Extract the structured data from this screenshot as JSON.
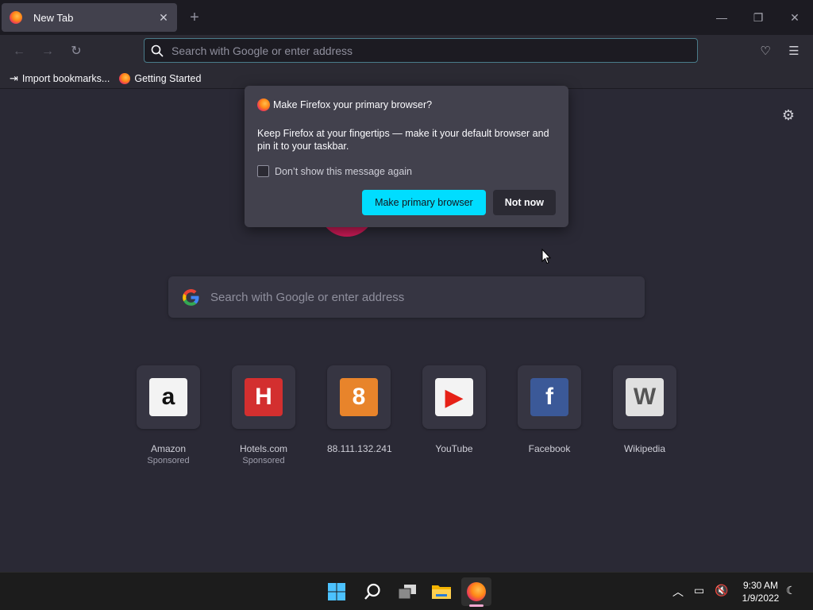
{
  "window": {
    "tab_title": "New Tab",
    "tab_close": "✕",
    "new_tab": "+",
    "minimize": "—",
    "restore": "❐",
    "close": "✕"
  },
  "navbar": {
    "back": "←",
    "forward": "→",
    "reload": "↻",
    "url_placeholder": "Search with Google or enter address",
    "pocket": "♡",
    "menu": "☰"
  },
  "bookmarks": {
    "items": [
      {
        "label": "Import bookmarks...",
        "icon": "import-icon"
      },
      {
        "label": "Getting Started",
        "icon": "firefox-icon"
      }
    ]
  },
  "newtab": {
    "search_placeholder": "Search with Google or enter address",
    "settings": "⚙",
    "tiles": [
      {
        "name": "Amazon",
        "sub": "Sponsored",
        "glyph": "a",
        "color": "#f3f3f3",
        "fg": "#111111"
      },
      {
        "name": "Hotels.com",
        "sub": "Sponsored",
        "glyph": "H",
        "color": "#d32f2f",
        "fg": "#ffffff"
      },
      {
        "name": "88.111.132.241",
        "sub": "",
        "glyph": "8",
        "color": "#e8842b",
        "fg": "#ffffff"
      },
      {
        "name": "YouTube",
        "sub": "",
        "glyph": "▶",
        "color": "#f3f3f3",
        "fg": "#e62117"
      },
      {
        "name": "Facebook",
        "sub": "",
        "glyph": "f",
        "color": "#3b5998",
        "fg": "#ffffff"
      },
      {
        "name": "Wikipedia",
        "sub": "",
        "glyph": "W",
        "color": "#e0e0e0",
        "fg": "#555555"
      }
    ]
  },
  "popup": {
    "title": "Make Firefox your primary browser?",
    "body": "Keep Firefox at your fingertips — make it your default browser and pin it to your taskbar.",
    "checkbox_label": "Don’t show this message again",
    "primary_button": "Make primary browser",
    "secondary_button": "Not now"
  },
  "taskbar": {
    "time": "9:30 AM",
    "date": "1/9/2022"
  },
  "colors": {
    "accent": "#00ddff",
    "background": "#2a2935"
  }
}
